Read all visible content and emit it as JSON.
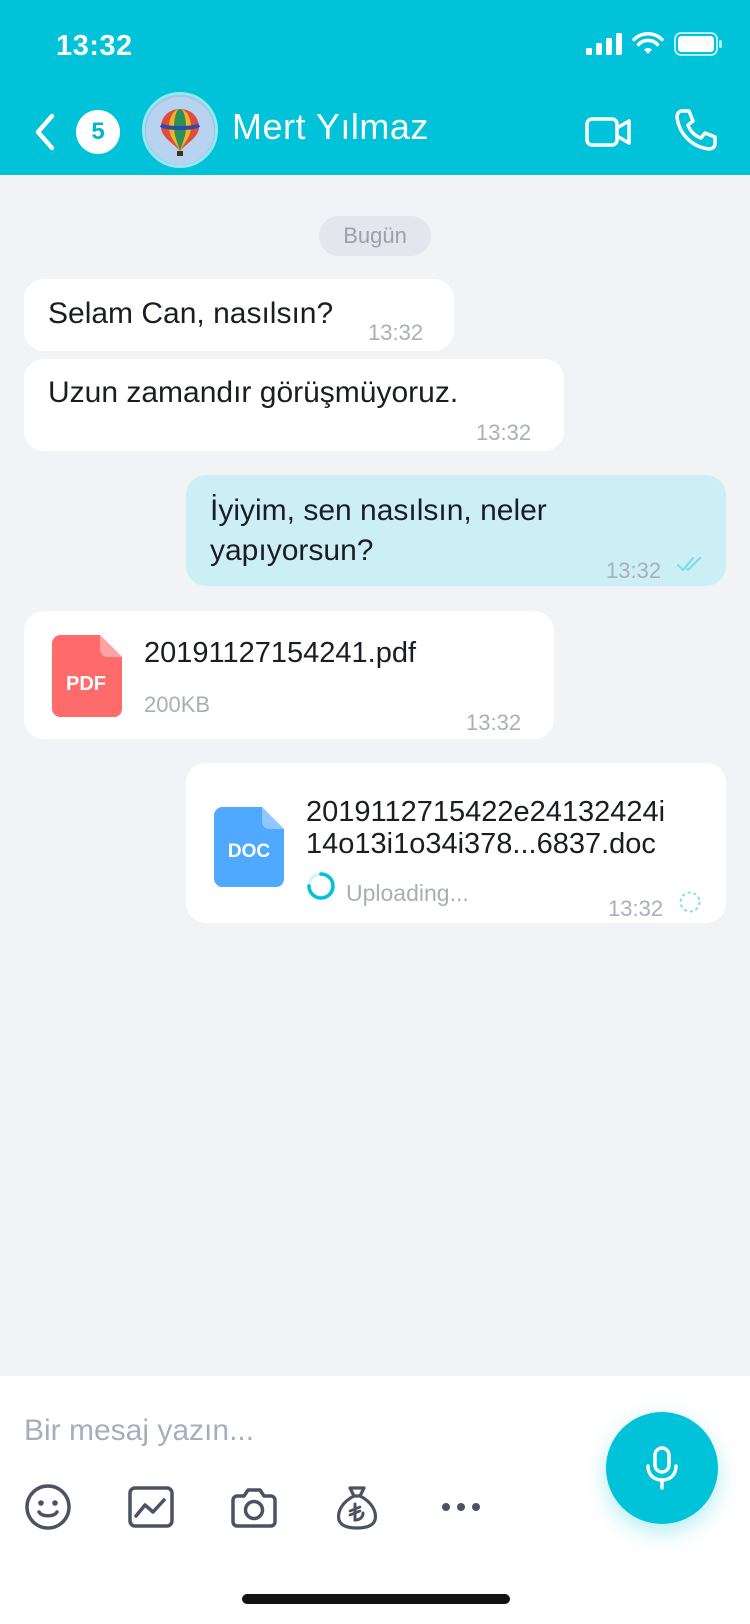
{
  "status_bar": {
    "time": "13:32"
  },
  "header": {
    "unread_count": "5",
    "contact_name": "Mert Yılmaz"
  },
  "chat": {
    "date_label": "Bugün",
    "messages": [
      {
        "direction": "in",
        "text": "Selam Can, nasılsın?",
        "time": "13:32"
      },
      {
        "direction": "in",
        "text": "Uzun zamandır görüşmüyoruz.",
        "time": "13:32"
      },
      {
        "direction": "out",
        "line1": "İyiyim, sen nasılsın, neler",
        "line2": "yapıyorsun?",
        "time": "13:32",
        "status": "read"
      },
      {
        "direction": "in",
        "type": "file",
        "file_type": "PDF",
        "file_name": "20191127154241.pdf",
        "file_size": "200KB",
        "time": "13:32"
      },
      {
        "direction": "out",
        "type": "file",
        "file_type": "DOC",
        "name_line1": "2019112715422e24132424i",
        "name_line2": "14o13i1o34i378...6837.doc",
        "upload_status": "Uploading...",
        "time": "13:32"
      }
    ]
  },
  "composer": {
    "placeholder": "Bir mesaj yazın..."
  },
  "colors": {
    "brand": "#00c2d8",
    "outgoing_bubble": "#cceff5",
    "pdf": "#ff6b6b",
    "doc": "#4fa9ff"
  },
  "icons": [
    "back-arrow-icon",
    "video-camera-icon",
    "phone-icon",
    "emoji-icon",
    "gallery-icon",
    "camera-icon",
    "money-bag-icon",
    "more-icon",
    "microphone-icon"
  ]
}
